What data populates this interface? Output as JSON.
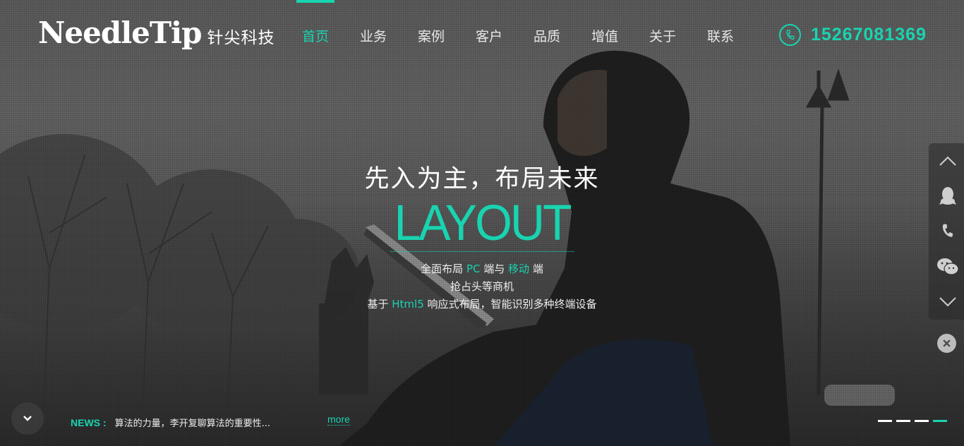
{
  "brand": {
    "name_en": "NeedleTip",
    "name_cn": "针尖科技"
  },
  "nav": {
    "items": [
      {
        "label": "首页",
        "active": true
      },
      {
        "label": "业务",
        "active": false
      },
      {
        "label": "案例",
        "active": false
      },
      {
        "label": "客户",
        "active": false
      },
      {
        "label": "品质",
        "active": false
      },
      {
        "label": "增值",
        "active": false
      },
      {
        "label": "关于",
        "active": false
      },
      {
        "label": "联系",
        "active": false
      }
    ]
  },
  "contact": {
    "phone": "15267081369",
    "icon": "phone-icon"
  },
  "hero": {
    "title": "先入为主，布局未来",
    "big_word": "LAYOUT",
    "line1": {
      "a": "全面布局 ",
      "b": "PC",
      "c": " 端与 ",
      "d": "移动",
      "e": " 端"
    },
    "line2": "抢占头等商机",
    "line3": {
      "a": "基于 ",
      "b": "Html5",
      "c": " 响应式布局，智能识别多种终端设备"
    }
  },
  "sidebar": {
    "icons": [
      "chevron-up-icon",
      "qq-icon",
      "phone-icon",
      "wechat-icon",
      "chevron-down-icon"
    ],
    "close_icon": "close-icon"
  },
  "news": {
    "label": "NEWS :",
    "text": "算法的力量，李开复聊算法的重要性...",
    "more": "more"
  },
  "slider": {
    "count": 4,
    "active_index": 3
  },
  "colors": {
    "accent": "#18d4b0",
    "text": "#ffffff"
  }
}
